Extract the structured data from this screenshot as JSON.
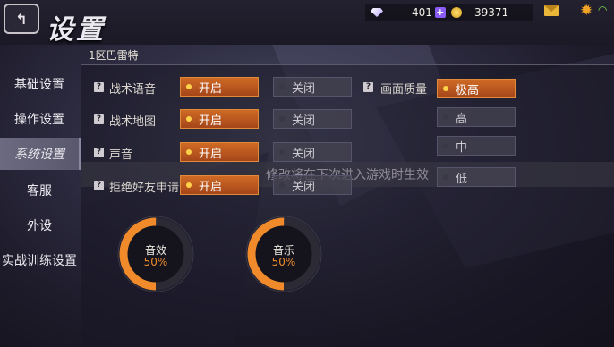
{
  "header": {
    "title": "设置",
    "gems": "401",
    "coins": "39371"
  },
  "subtitle": "1区巴雷特",
  "sidebar": {
    "items": [
      {
        "label": "基础设置"
      },
      {
        "label": "操作设置"
      },
      {
        "label": "系统设置",
        "active": true
      },
      {
        "label": "客服"
      },
      {
        "label": "外设"
      },
      {
        "label": "实战训练设置"
      }
    ]
  },
  "settings": {
    "rows": [
      {
        "label": "战术语音",
        "on_label": "开启",
        "off_label": "关闭",
        "selected": "on"
      },
      {
        "label": "战术地图",
        "on_label": "开启",
        "off_label": "关闭",
        "selected": "on"
      },
      {
        "label": "声音",
        "on_label": "开启",
        "off_label": "关闭",
        "selected": "on"
      },
      {
        "label": "拒绝好友申请",
        "on_label": "开启",
        "off_label": "关闭",
        "selected": "on"
      }
    ],
    "quality": {
      "label": "画面质量",
      "options": [
        "极高",
        "高",
        "中",
        "低"
      ],
      "selected": "极高"
    }
  },
  "notice": "修改将在下次进入游戏时生效",
  "dials": {
    "sfx": {
      "label": "音效",
      "value": "50%",
      "level": 0.5
    },
    "music": {
      "label": "音乐",
      "value": "50%",
      "level": 0.5
    }
  },
  "colors": {
    "accent": "#f08a2a",
    "selected_option": "#c15a20",
    "background": "#2c2b3e"
  },
  "icons": [
    "back-icon",
    "diamond-icon",
    "plus-icon",
    "coin-icon",
    "mail-icon",
    "gear-icon",
    "wifi-icon",
    "help-icon"
  ]
}
